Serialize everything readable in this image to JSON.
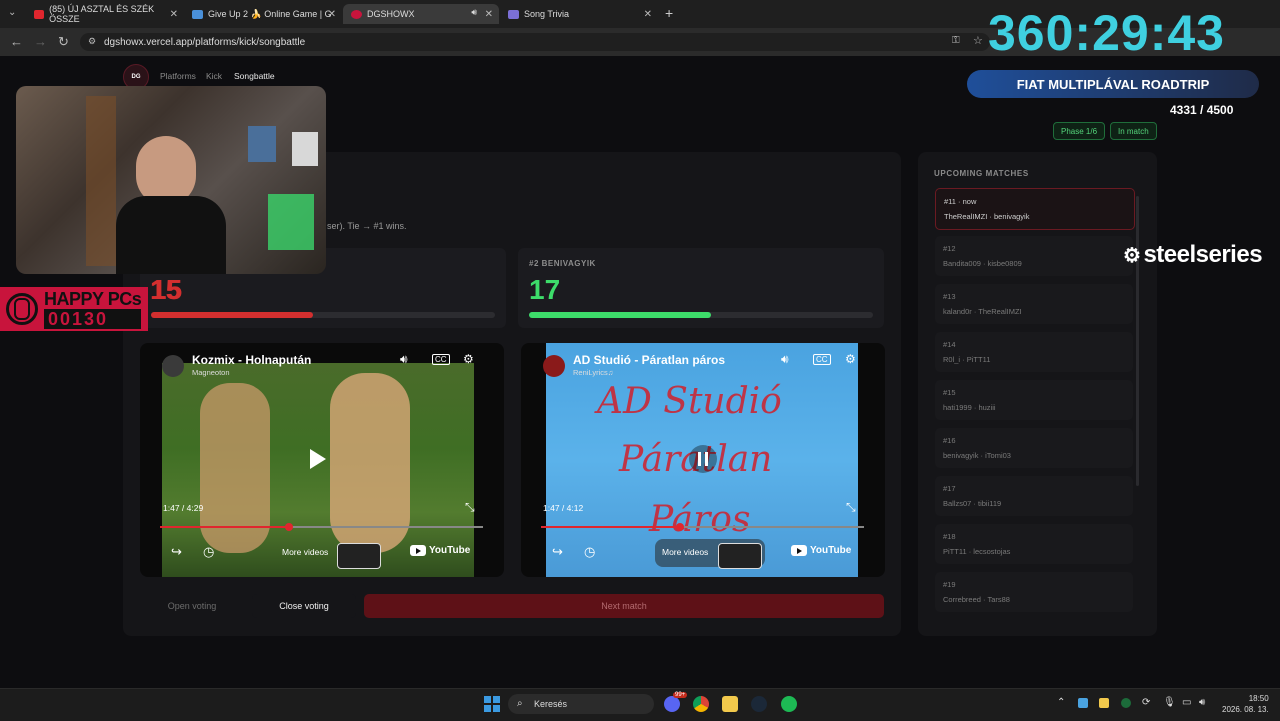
{
  "browser": {
    "tabs": [
      {
        "label": "(85) ÚJ ASZTAL ÉS SZÉK ÖSSZE",
        "icon": "youtube-icon",
        "color": "#e0262e"
      },
      {
        "label": "Give Up 2 🍌 Online Game | G",
        "icon": "game-icon",
        "color": "#4a90d9"
      },
      {
        "label": "DGSHOWX",
        "icon": "dgshowx-icon",
        "color": "#c8143c"
      },
      {
        "label": "Song Trivia",
        "icon": "trivia-icon",
        "color": "#7b6fd6"
      }
    ],
    "url": "dgshowx.vercel.app/platforms/kick/songbattle"
  },
  "nav": {
    "breadcrumb": [
      "Platforms",
      "Kick",
      "Songbattle"
    ]
  },
  "status": {
    "phase": "Phase 1/6",
    "state": "In match"
  },
  "battle": {
    "rule_text": "ser). Tie → #1 wins.",
    "left": {
      "score": "15",
      "progress": 0.47,
      "color": "#d32f2f"
    },
    "right": {
      "label": "#2 BENIVAGYIK",
      "score": "17",
      "progress": 0.53,
      "color": "#3ddc6a"
    }
  },
  "videos": [
    {
      "title": "Kozmix - Holnaputá",
      "title_full": "Kozmix - Holnapután",
      "channel": "Magneoton",
      "time": "1:47 / 4:29",
      "progress": 0.4,
      "more": "More videos",
      "brand": "YouTube",
      "state": "paused"
    },
    {
      "title": "AD Studió - Páratlan páros",
      "channel": "ReniLyrics♫",
      "time": "1:47 / 4:12",
      "progress": 0.43,
      "more": "More videos",
      "brand": "YouTube",
      "state": "playing",
      "overlay_lines": [
        "AD Studió",
        "Páratlan",
        "Páros"
      ]
    }
  ],
  "actions": {
    "open_voting": "Open voting",
    "close_voting": "Close voting",
    "next_match": "Next match"
  },
  "upcoming": {
    "title": "UPCOMING MATCHES",
    "matches": [
      {
        "num": "#11 · now",
        "players": "TheRealIMZI · benivagyik",
        "current": true
      },
      {
        "num": "#12",
        "players": "Bandita009 · kisbe0809"
      },
      {
        "num": "#13",
        "players": "kaland0r · TheRealIMZI"
      },
      {
        "num": "#14",
        "players": "R0l_i · PiTT11"
      },
      {
        "num": "#15",
        "players": "hati1999 · huziii"
      },
      {
        "num": "#16",
        "players": "benivagyik · iTomi03"
      },
      {
        "num": "#17",
        "players": "Ballzs07 · tibii119"
      },
      {
        "num": "#18",
        "players": "PiTT11 · lecsostojas"
      },
      {
        "num": "#19",
        "players": "Correbreed · Tars88"
      }
    ]
  },
  "overlay": {
    "timer": "360:29:43",
    "goal_title": "FIAT MULTIPLÁVAL ROADTRIP",
    "goal_count": "4331 / 4500",
    "sponsor": "steelseries",
    "happy_top": "HAPPY PCs",
    "happy_bottom": "00130"
  },
  "taskbar": {
    "search": "Keresés",
    "time": "18:50",
    "date": "2026. 08. 13.",
    "badge": "99+"
  }
}
